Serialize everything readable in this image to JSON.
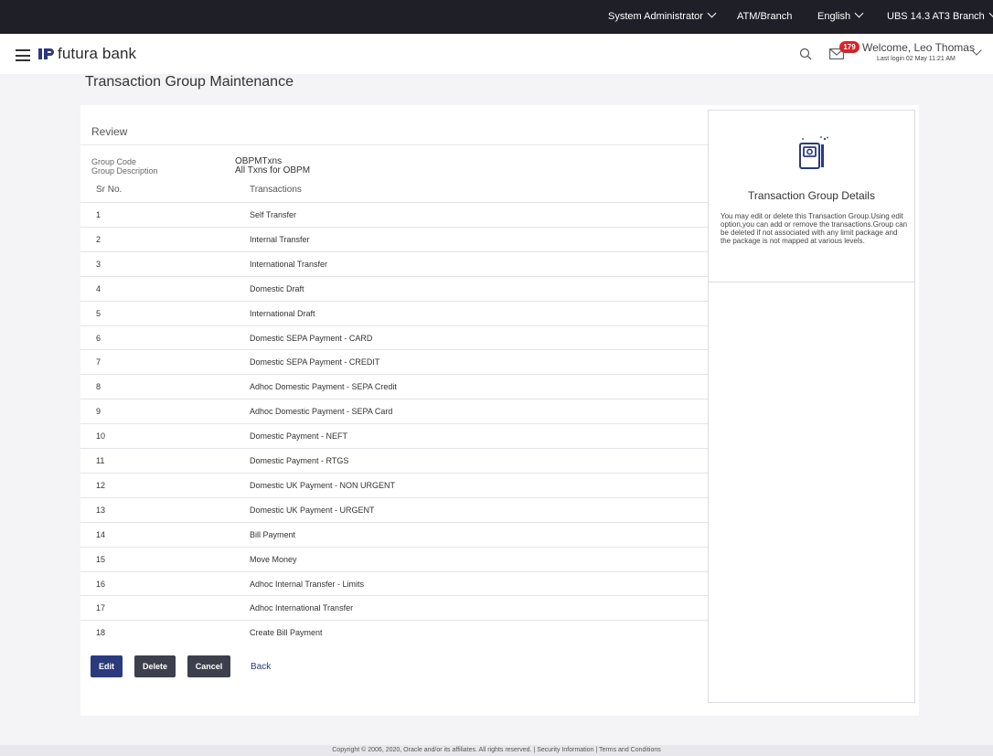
{
  "topbar": {
    "role": "System Administrator",
    "atm_branch": "ATM/Branch",
    "language": "English",
    "branch": "UBS 14.3 AT3 Branch"
  },
  "header": {
    "logo_text": "futura bank",
    "notification_count": "179",
    "welcome": "Welcome, Leo Thomas",
    "last_login": "Last login 02 May 11:21 AM"
  },
  "page": {
    "title": "Transaction Group Maintenance"
  },
  "review": {
    "title": "Review",
    "group_code_label": "Group Code",
    "group_code_value": "OBPMTxns",
    "group_description_label": "Group Description",
    "group_description_value": "All Txns for OBPM",
    "col_sr": "Sr No.",
    "col_txn": "Transactions",
    "rows": [
      {
        "sr": "1",
        "txn": "Self Transfer"
      },
      {
        "sr": "2",
        "txn": "Internal Transfer"
      },
      {
        "sr": "3",
        "txn": "International Transfer"
      },
      {
        "sr": "4",
        "txn": "Domestic Draft"
      },
      {
        "sr": "5",
        "txn": "International Draft"
      },
      {
        "sr": "6",
        "txn": "Domestic SEPA Payment - CARD"
      },
      {
        "sr": "7",
        "txn": "Domestic SEPA Payment - CREDIT"
      },
      {
        "sr": "8",
        "txn": "Adhoc Domestic Payment - SEPA Credit"
      },
      {
        "sr": "9",
        "txn": "Adhoc Domestic Payment - SEPA Card"
      },
      {
        "sr": "10",
        "txn": "Domestic Payment - NEFT"
      },
      {
        "sr": "11",
        "txn": "Domestic Payment - RTGS"
      },
      {
        "sr": "12",
        "txn": "Domestic UK Payment - NON URGENT"
      },
      {
        "sr": "13",
        "txn": "Domestic UK Payment - URGENT"
      },
      {
        "sr": "14",
        "txn": "Bill Payment"
      },
      {
        "sr": "15",
        "txn": "Move Money"
      },
      {
        "sr": "16",
        "txn": "Adhoc Internal Transfer - Limits"
      },
      {
        "sr": "17",
        "txn": "Adhoc International Transfer"
      },
      {
        "sr": "18",
        "txn": "Create Bill Payment"
      }
    ]
  },
  "actions": {
    "edit": "Edit",
    "delete": "Delete",
    "cancel": "Cancel",
    "back": "Back"
  },
  "side_panel": {
    "title": "Transaction Group Details",
    "text": "You may edit or delete this Transaction Group.Using edit option,you can add or remove the transactions.Group can be deleted if not associated with any limit package and the package is not mapped at various levels."
  },
  "footer": {
    "text": "Copyright © 2006, 2020, Oracle and/or its affiliates. All rights reserved. | Security Information | Terms and Conditions"
  },
  "colors": {
    "topbar": "#1f1f27",
    "primary_button": "#2a3a7c",
    "secondary_button": "#3d3f4d",
    "badge": "#d8232a",
    "logo_accent": "#2a3a7c"
  }
}
